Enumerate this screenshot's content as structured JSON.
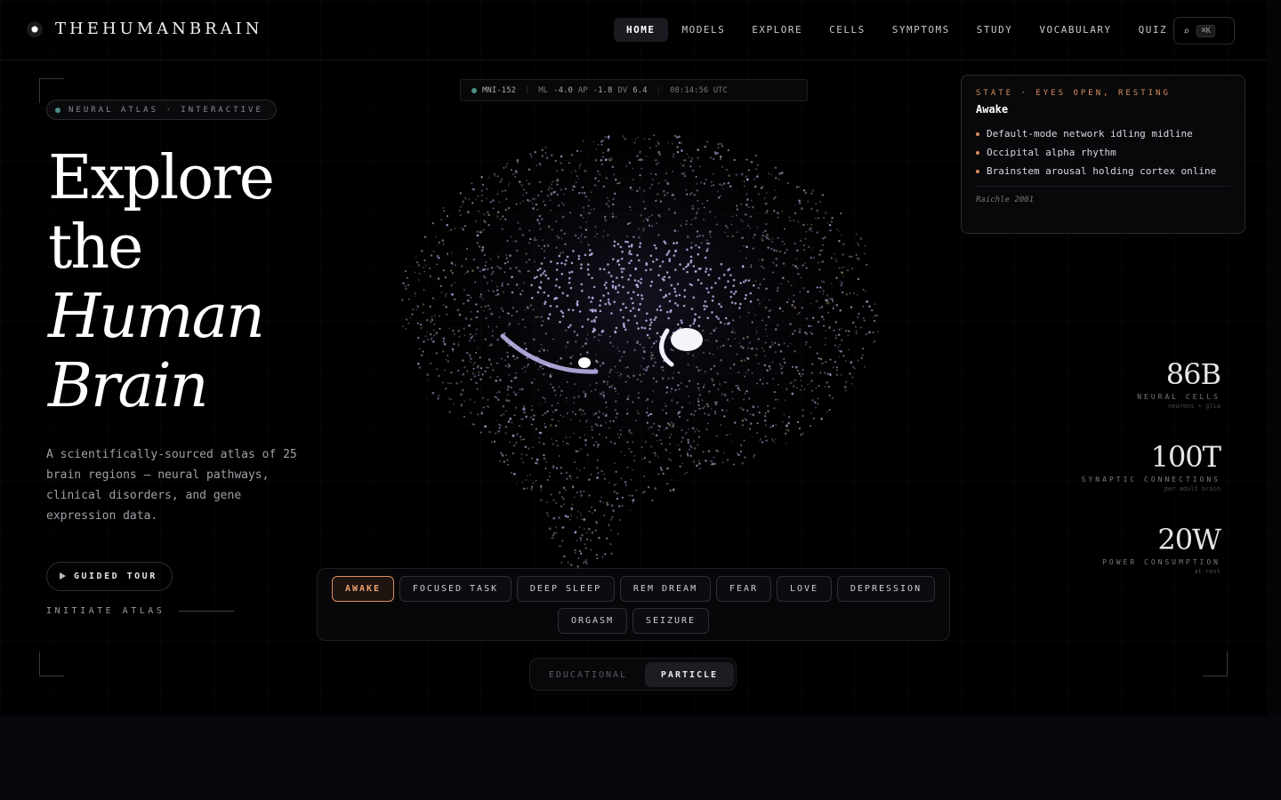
{
  "brand": {
    "name": "THEHUMANBRAIN"
  },
  "nav": {
    "links": [
      "HOME",
      "MODELS",
      "EXPLORE",
      "CELLS",
      "SYMPTOMS",
      "STUDY",
      "VOCABULARY",
      "QUIZ"
    ],
    "active": "HOME",
    "search_icon": "search-icon",
    "shortcut": "⌘K"
  },
  "hero": {
    "badge": "NEURAL ATLAS · INTERACTIVE",
    "title_line1": "Explore",
    "title_line2": "the",
    "title_line3": "Human",
    "title_line4": "Brain",
    "description": "A scientifically-sourced atlas of 25 brain regions — neural pathways, clinical disorders, and gene expression data.",
    "tour_label": "GUIDED TOUR",
    "initiate_label": "INITIATE ATLAS"
  },
  "readout": {
    "space": "MNI-152",
    "ml_label": "ML",
    "ml_value": "-4.0",
    "ap_label": "AP",
    "ap_value": "-1.8",
    "dv_label": "DV",
    "dv_value": "6.4",
    "time": "08:14:56 UTC"
  },
  "state_card": {
    "label": "STATE · EYES OPEN, RESTING",
    "title": "Awake",
    "bullets": [
      "Default-mode network idling midline",
      "Occipital alpha rhythm",
      "Brainstem arousal holding cortex online"
    ],
    "citation": "Raichle 2001"
  },
  "stats": [
    {
      "value": "86B",
      "label": "NEURAL CELLS",
      "sub": "neurons + glia"
    },
    {
      "value": "100T",
      "label": "SYNAPTIC CONNECTIONS",
      "sub": "per adult brain"
    },
    {
      "value": "20W",
      "label": "POWER CONSUMPTION",
      "sub": "at rest"
    }
  ],
  "states": {
    "options": [
      "AWAKE",
      "FOCUSED TASK",
      "DEEP SLEEP",
      "REM DREAM",
      "FEAR",
      "LOVE",
      "DEPRESSION",
      "ORGASM",
      "SEIZURE"
    ],
    "active": "AWAKE"
  },
  "mode": {
    "educational": "EDUCATIONAL",
    "particle": "PARTICLE",
    "active": "PARTICLE"
  },
  "colors": {
    "accent": "#d98f5e",
    "teal": "#4c8f86",
    "particle_violet": "#b8a8f0"
  }
}
